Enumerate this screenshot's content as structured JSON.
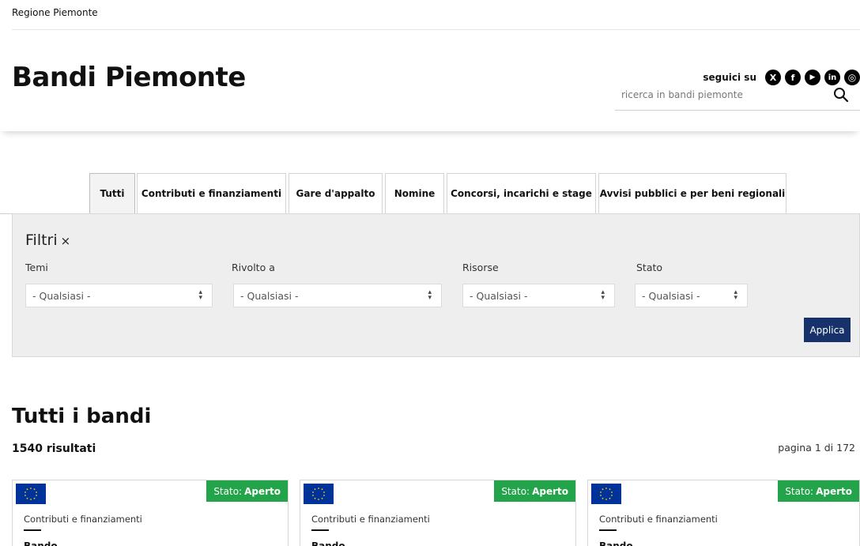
{
  "topbar": {
    "region": "Regione Piemonte"
  },
  "header": {
    "title": "Bandi Piemonte",
    "follow_label": "seguici su",
    "social": [
      {
        "icon": "x-icon",
        "glyph": "X"
      },
      {
        "icon": "facebook-icon",
        "glyph": "f"
      },
      {
        "icon": "youtube-icon",
        "glyph": "▶"
      },
      {
        "icon": "linkedin-icon",
        "glyph": "in"
      },
      {
        "icon": "instagram-icon",
        "glyph": "◎"
      }
    ],
    "search": {
      "placeholder": "ricerca in bandi piemonte",
      "value": "",
      "icon": "search-icon"
    }
  },
  "tabs": [
    {
      "label": "Tutti",
      "active": true
    },
    {
      "label": "Contributi e finanziamenti",
      "active": false
    },
    {
      "label": "Gare d'appalto",
      "active": false
    },
    {
      "label": "Nomine",
      "active": false
    },
    {
      "label": "Concorsi, incarichi e stage",
      "active": false
    },
    {
      "label": "Avvisi pubblici e per beni regionali",
      "active": false
    }
  ],
  "filters": {
    "title": "Filtri",
    "close_glyph": "×",
    "fields": [
      {
        "label": "Temi",
        "selected": "- Qualsiasi -"
      },
      {
        "label": "Rivolto a",
        "selected": "- Qualsiasi -"
      },
      {
        "label": "Risorse",
        "selected": "- Qualsiasi -"
      },
      {
        "label": "Stato",
        "selected": "- Qualsiasi -"
      }
    ],
    "apply_label": "Applica"
  },
  "results": {
    "title": "Tutti i bandi",
    "count": "1540 risultati",
    "page_info": "pagina 1 di 172"
  },
  "cards": [
    {
      "status_prefix": "Stato:",
      "status_value": "Aperto",
      "category": "Contributi e finanziamenti",
      "type": "Bando"
    },
    {
      "status_prefix": "Stato:",
      "status_value": "Aperto",
      "category": "Contributi e finanziamenti",
      "type": "Bando"
    },
    {
      "status_prefix": "Stato:",
      "status_value": "Aperto",
      "category": "Contributi e finanziamenti",
      "type": "Bando"
    }
  ],
  "colors": {
    "status_open": "#23a34a",
    "apply_button": "#17326b",
    "eu_flag_blue": "#003399",
    "eu_flag_stars": "#ffcc00"
  }
}
